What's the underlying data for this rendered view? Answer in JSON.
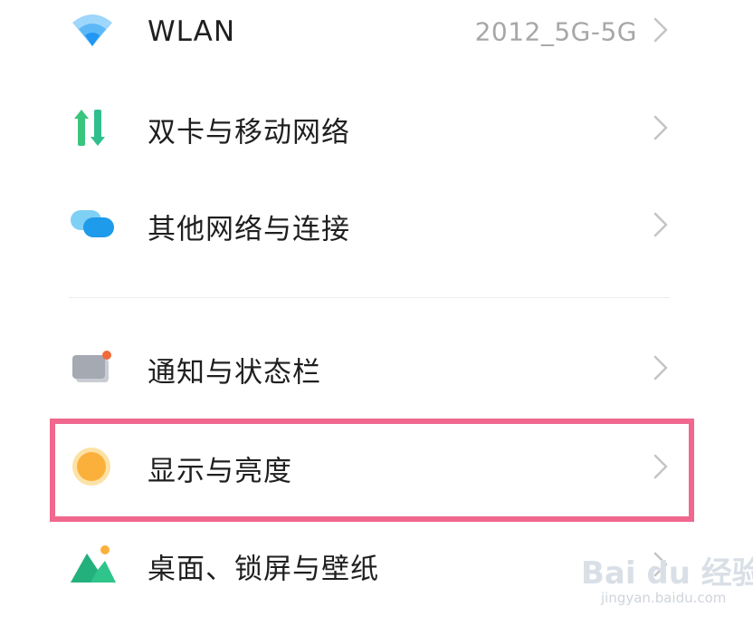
{
  "settings": {
    "items": [
      {
        "label": "WLAN",
        "value": "2012_5G-5G",
        "icon": "wifi-icon"
      },
      {
        "label": "双卡与移动网络",
        "value": "",
        "icon": "mobile-network-icon"
      },
      {
        "label": "其他网络与连接",
        "value": "",
        "icon": "connections-icon"
      },
      {
        "label": "通知与状态栏",
        "value": "",
        "icon": "notification-icon"
      },
      {
        "label": "显示与亮度",
        "value": "",
        "icon": "brightness-icon"
      },
      {
        "label": "桌面、锁屏与壁纸",
        "value": "",
        "icon": "wallpaper-icon"
      }
    ]
  },
  "highlight_color": "#f0688e",
  "watermark": {
    "brand": "Bai du 经验",
    "url": "jingyan.baidu.com"
  }
}
